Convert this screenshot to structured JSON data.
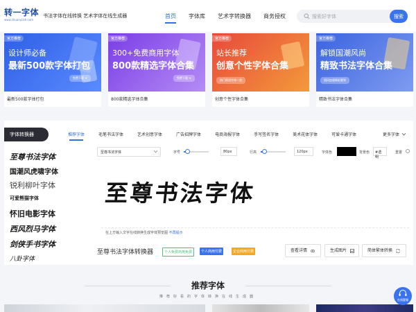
{
  "header": {
    "logo_main": "转一字体",
    "logo_sub": "www.zhuanyiziti.com",
    "slogan": "书法字体在线转换 艺术字体在线生成器",
    "nav": [
      "首页",
      "字体库",
      "艺术字转换器",
      "商务授权"
    ],
    "search_placeholder": "搜索好字体",
    "search_button": "搜索"
  },
  "banners": [
    {
      "tag": "官方推荐",
      "line1": "设计师必备",
      "line2": "最新500款字体打包",
      "cta": "免费下载 ➔",
      "caption": "最新500款字体打包",
      "color1": "#2f5fe6",
      "color2": "#5a8bff"
    },
    {
      "tag": "官方推荐",
      "line1": "300+免费商用字体",
      "line2": "800款精选字体合集",
      "cta": "免费下载 ➔",
      "caption": "800款精选字体合集",
      "color1": "#7b3de6",
      "color2": "#b48cf5"
    },
    {
      "tag": "官方推荐",
      "line1": "站长推荐",
      "line2": "创意个性字体合集",
      "cta": "热门原创字体一览",
      "caption": "创意个性字体合集",
      "color1": "#e8493b",
      "color2": "#f39a3b"
    },
    {
      "tag": "官方推荐",
      "line1": "解锁国潮风尚",
      "line2": "精致书法字体合集",
      "cta": "国风加速精彩题到",
      "caption": "精致书法字体合集",
      "color1": "#3b63e0",
      "color2": "#7f9cf0"
    }
  ],
  "converter": {
    "title": "字体转换器",
    "tabs": [
      "推荐字体",
      "毛笔书法字体",
      "艺术创意字体",
      "广告招牌字体",
      "电商海报字体",
      "手写签名字体",
      "美术花体字体",
      "可爱卡通字体"
    ],
    "more": "更多字体",
    "styles": [
      "至尊书法字体",
      "国潮风虎啸字体",
      "锐利柳叶字体",
      "可爱熊猫字体",
      "怀旧电影字体",
      "西风烈马字体",
      "剑侠手书字体",
      "八卦字体"
    ],
    "selected_font": "至尊书法字体",
    "size_label": "字号",
    "size_value": "80px",
    "size_level": 0.15,
    "line_label": "行高",
    "line_value": "120px",
    "line_level": 0.15,
    "color_label": "字体色",
    "text_color": "#000000",
    "bg_label": "背景色",
    "bg_value": "#透明",
    "reset_label": "重置",
    "preview_text": "至尊书法字体",
    "hint_text": "在上方输入文字在线转换生成字体预览图",
    "hint_link": "不再提示",
    "result_title": "至尊书法字体转换器",
    "badges": [
      "个人免费商用免费",
      "个人商用付费",
      "企业商用付费"
    ],
    "actions": [
      "查看详情",
      "生成图片",
      "简体繁体转换"
    ]
  },
  "recommend": {
    "title": "推荐字体",
    "subtitle": "推荐好看的字体转换在线生成器"
  },
  "float_help": "在线客服"
}
